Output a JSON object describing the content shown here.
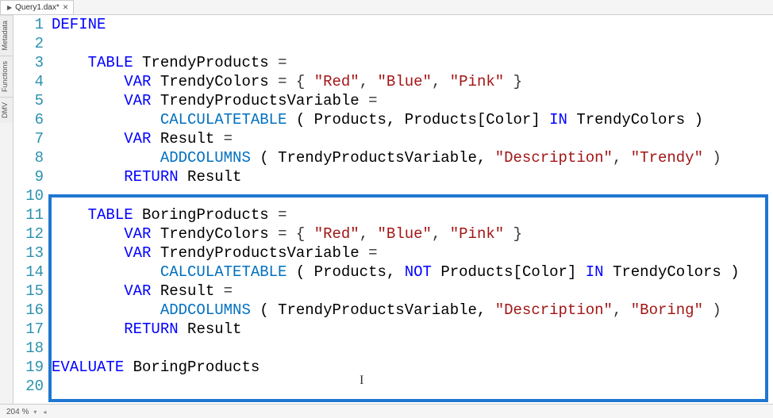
{
  "tab": {
    "title": "Query1.dax*"
  },
  "side_tabs": [
    "Metadata",
    "Functions",
    "DMV"
  ],
  "status": {
    "zoom": "204 %"
  },
  "code": {
    "lines": [
      {
        "n": 1,
        "tokens": [
          {
            "t": "DEFINE",
            "c": "kw"
          }
        ]
      },
      {
        "n": 2,
        "tokens": []
      },
      {
        "n": 3,
        "tokens": [
          {
            "t": "    ",
            "c": "id"
          },
          {
            "t": "TABLE",
            "c": "kw"
          },
          {
            "t": " TrendyProducts ",
            "c": "id"
          },
          {
            "t": "=",
            "c": "punc"
          }
        ]
      },
      {
        "n": 4,
        "tokens": [
          {
            "t": "        ",
            "c": "id"
          },
          {
            "t": "VAR",
            "c": "kw"
          },
          {
            "t": " TrendyColors ",
            "c": "id"
          },
          {
            "t": "= { ",
            "c": "punc"
          },
          {
            "t": "\"Red\"",
            "c": "str"
          },
          {
            "t": ", ",
            "c": "punc"
          },
          {
            "t": "\"Blue\"",
            "c": "str"
          },
          {
            "t": ", ",
            "c": "punc"
          },
          {
            "t": "\"Pink\"",
            "c": "str"
          },
          {
            "t": " }",
            "c": "punc"
          }
        ]
      },
      {
        "n": 5,
        "tokens": [
          {
            "t": "        ",
            "c": "id"
          },
          {
            "t": "VAR",
            "c": "kw"
          },
          {
            "t": " TrendyProductsVariable ",
            "c": "id"
          },
          {
            "t": "=",
            "c": "punc"
          }
        ]
      },
      {
        "n": 6,
        "tokens": [
          {
            "t": "            ",
            "c": "id"
          },
          {
            "t": "CALCULATETABLE",
            "c": "fn"
          },
          {
            "t": " ( Products, Products[Color] ",
            "c": "id"
          },
          {
            "t": "IN",
            "c": "kw"
          },
          {
            "t": " TrendyColors )",
            "c": "id"
          }
        ]
      },
      {
        "n": 7,
        "tokens": [
          {
            "t": "        ",
            "c": "id"
          },
          {
            "t": "VAR",
            "c": "kw"
          },
          {
            "t": " Result ",
            "c": "id"
          },
          {
            "t": "=",
            "c": "punc"
          }
        ]
      },
      {
        "n": 8,
        "tokens": [
          {
            "t": "            ",
            "c": "id"
          },
          {
            "t": "ADDCOLUMNS",
            "c": "fn"
          },
          {
            "t": " ( TrendyProductsVariable, ",
            "c": "id"
          },
          {
            "t": "\"Description\"",
            "c": "str"
          },
          {
            "t": ", ",
            "c": "punc"
          },
          {
            "t": "\"Trendy\"",
            "c": "str"
          },
          {
            "t": " )",
            "c": "punc"
          }
        ]
      },
      {
        "n": 9,
        "tokens": [
          {
            "t": "        ",
            "c": "id"
          },
          {
            "t": "RETURN",
            "c": "kw"
          },
          {
            "t": " Result",
            "c": "id"
          }
        ]
      },
      {
        "n": 10,
        "tokens": []
      },
      {
        "n": 11,
        "tokens": [
          {
            "t": "    ",
            "c": "id"
          },
          {
            "t": "TABLE",
            "c": "kw"
          },
          {
            "t": " BoringProducts ",
            "c": "id"
          },
          {
            "t": "=",
            "c": "punc"
          }
        ]
      },
      {
        "n": 12,
        "tokens": [
          {
            "t": "        ",
            "c": "id"
          },
          {
            "t": "VAR",
            "c": "kw"
          },
          {
            "t": " TrendyColors ",
            "c": "id"
          },
          {
            "t": "= { ",
            "c": "punc"
          },
          {
            "t": "\"Red\"",
            "c": "str"
          },
          {
            "t": ", ",
            "c": "punc"
          },
          {
            "t": "\"Blue\"",
            "c": "str"
          },
          {
            "t": ", ",
            "c": "punc"
          },
          {
            "t": "\"Pink\"",
            "c": "str"
          },
          {
            "t": " }",
            "c": "punc"
          }
        ]
      },
      {
        "n": 13,
        "tokens": [
          {
            "t": "        ",
            "c": "id"
          },
          {
            "t": "VAR",
            "c": "kw"
          },
          {
            "t": " TrendyProductsVariable ",
            "c": "id"
          },
          {
            "t": "=",
            "c": "punc"
          }
        ]
      },
      {
        "n": 14,
        "tokens": [
          {
            "t": "            ",
            "c": "id"
          },
          {
            "t": "CALCULATETABLE",
            "c": "fn"
          },
          {
            "t": " ( Products, ",
            "c": "id"
          },
          {
            "t": "NOT",
            "c": "kw"
          },
          {
            "t": " Products[Color] ",
            "c": "id"
          },
          {
            "t": "IN",
            "c": "kw"
          },
          {
            "t": " TrendyColors )",
            "c": "id"
          }
        ]
      },
      {
        "n": 15,
        "tokens": [
          {
            "t": "        ",
            "c": "id"
          },
          {
            "t": "VAR",
            "c": "kw"
          },
          {
            "t": " Result ",
            "c": "id"
          },
          {
            "t": "=",
            "c": "punc"
          }
        ]
      },
      {
        "n": 16,
        "tokens": [
          {
            "t": "            ",
            "c": "id"
          },
          {
            "t": "ADDCOLUMNS",
            "c": "fn"
          },
          {
            "t": " ( TrendyProductsVariable, ",
            "c": "id"
          },
          {
            "t": "\"Description\"",
            "c": "str"
          },
          {
            "t": ", ",
            "c": "punc"
          },
          {
            "t": "\"Boring\"",
            "c": "str"
          },
          {
            "t": " )",
            "c": "punc"
          }
        ]
      },
      {
        "n": 17,
        "tokens": [
          {
            "t": "        ",
            "c": "id"
          },
          {
            "t": "RETURN",
            "c": "kw"
          },
          {
            "t": " Result",
            "c": "id"
          }
        ]
      },
      {
        "n": 18,
        "tokens": [
          {
            "t": "        ",
            "c": "id"
          }
        ]
      },
      {
        "n": 19,
        "tokens": [
          {
            "t": "EVALUATE",
            "c": "kw"
          },
          {
            "t": " BoringProducts",
            "c": "id"
          }
        ]
      },
      {
        "n": 20,
        "tokens": []
      }
    ]
  }
}
